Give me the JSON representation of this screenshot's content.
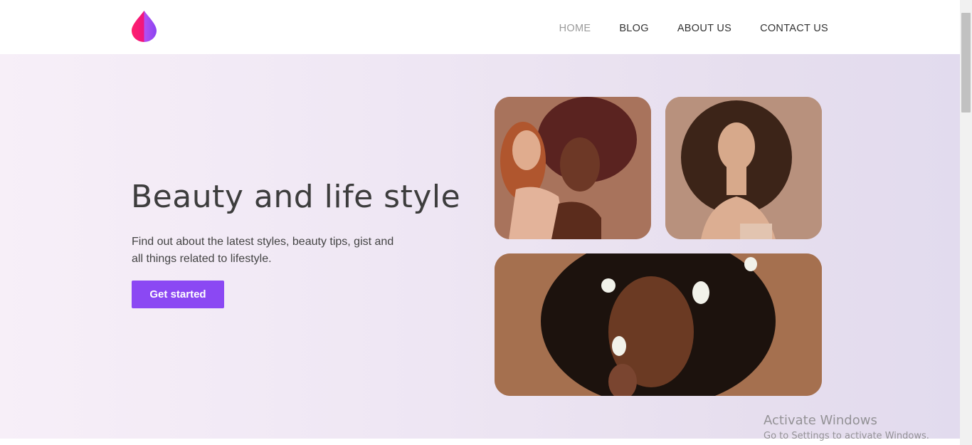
{
  "nav": {
    "items": [
      {
        "label": "HOME",
        "active": true
      },
      {
        "label": "BLOG",
        "active": false
      },
      {
        "label": "ABOUT US",
        "active": false
      },
      {
        "label": "CONTACT US",
        "active": false
      }
    ],
    "logo_icon": "droplet-logo-icon"
  },
  "hero": {
    "title": "Beauty and life style",
    "subtitle": "Find out about the latest styles, beauty tips, gist and all things related to lifestyle.",
    "cta_label": "Get started",
    "accent_color": "#8b48f3"
  },
  "gallery": {
    "images": [
      {
        "name": "two-women-portrait"
      },
      {
        "name": "curly-hair-woman-smiling"
      },
      {
        "name": "woman-with-flowers-in-hair"
      }
    ]
  },
  "watermark": {
    "title": "Activate Windows",
    "subtitle": "Go to Settings to activate Windows."
  }
}
